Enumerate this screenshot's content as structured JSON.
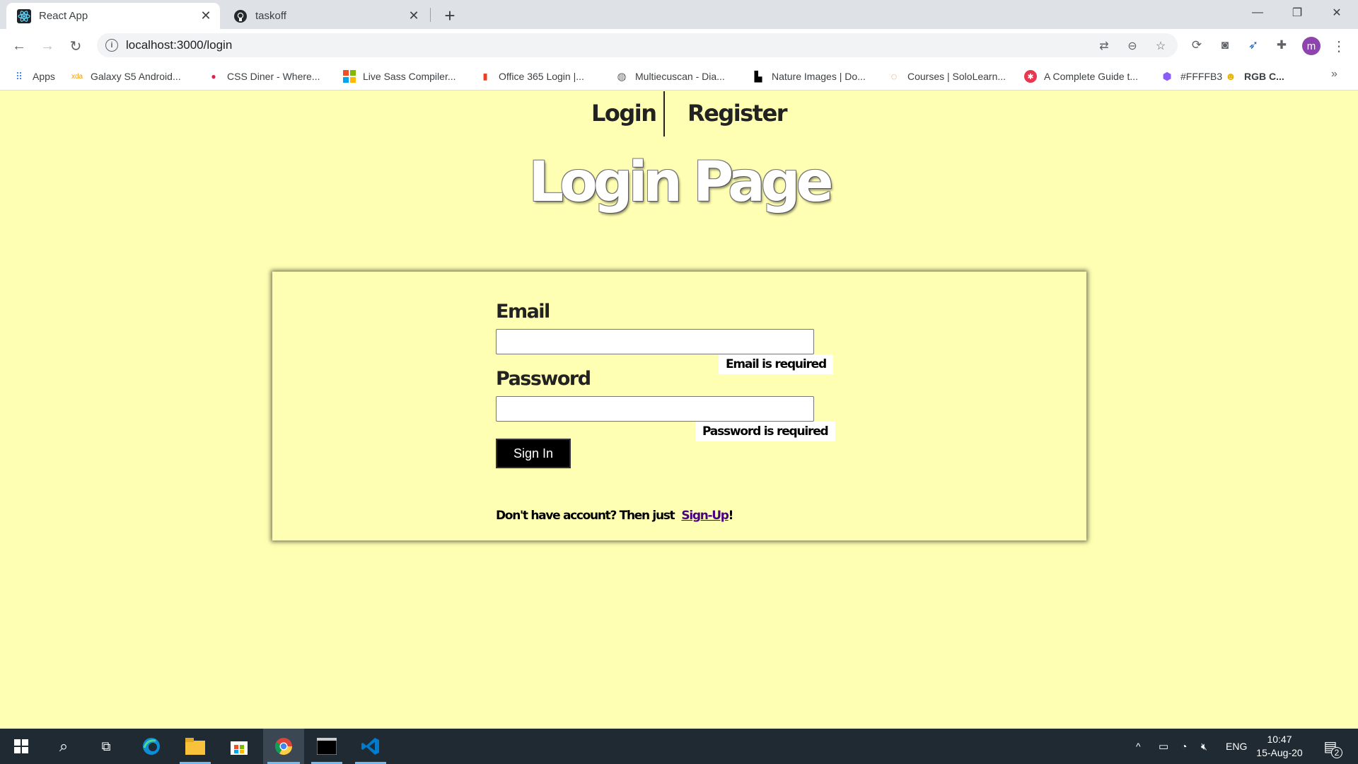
{
  "browser": {
    "tabs": [
      {
        "title": "React App",
        "icon": "react-icon"
      },
      {
        "title": "taskoff",
        "icon": "github-icon"
      }
    ],
    "new_tab_label": "+",
    "url": "localhost:3000/login",
    "profile_initial": "m",
    "bookmarks": [
      {
        "label": "Apps",
        "icon": "apps-grid-icon"
      },
      {
        "label": "Galaxy S5 Android...",
        "icon": "xda-icon"
      },
      {
        "label": "CSS Diner - Where...",
        "icon": "css-diner-icon"
      },
      {
        "label": "Live Sass Compiler...",
        "icon": "windows-logo-icon"
      },
      {
        "label": "Office 365 Login |...",
        "icon": "office-icon"
      },
      {
        "label": "Multiecuscan - Dia...",
        "icon": "globe-icon"
      },
      {
        "label": "Nature Images | Do...",
        "icon": "unsplash-icon"
      },
      {
        "label": "Courses | SoloLearn...",
        "icon": "sololearn-icon"
      },
      {
        "label": "A Complete Guide t...",
        "icon": "csstricks-icon"
      },
      {
        "label": "#FFFFB3",
        "icon": "color-hexagon-icon"
      },
      {
        "label": "RGB C...",
        "icon": "rgb-icon"
      }
    ],
    "bookmarks_more": "»"
  },
  "page": {
    "nav": {
      "login": "Login",
      "register": "Register"
    },
    "title": "Login Page",
    "form": {
      "email_label": "Email",
      "email_value": "",
      "email_error": "Email is required",
      "password_label": "Password",
      "password_value": "",
      "password_error": "Password is required",
      "signin_label": "Sign In",
      "footer_prefix": "Don't have account? Then just",
      "signup_link": "Sign-Up",
      "footer_suffix": "!"
    }
  },
  "taskbar": {
    "language": "ENG",
    "time": "10:47",
    "date": "15-Aug-20",
    "notification_count": "2"
  },
  "colors": {
    "page_background": "#FFFFB3",
    "signup_link": "#4B0082",
    "button_bg": "#000000"
  }
}
